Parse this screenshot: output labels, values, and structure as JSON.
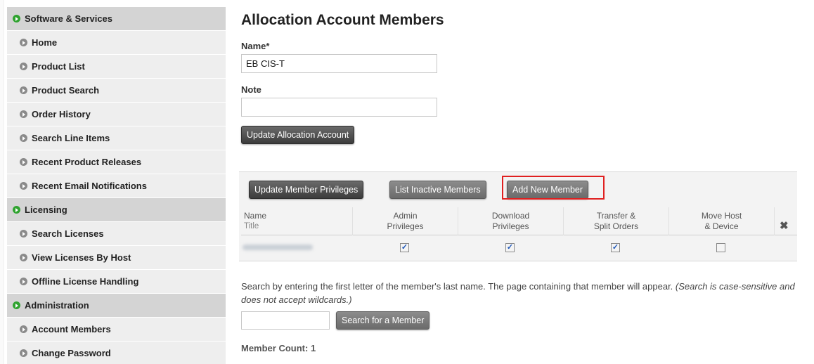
{
  "sidebar": {
    "items": [
      {
        "label": "Software & Services",
        "type": "section"
      },
      {
        "label": "Home",
        "type": "item"
      },
      {
        "label": "Product List",
        "type": "item"
      },
      {
        "label": "Product Search",
        "type": "item"
      },
      {
        "label": "Order History",
        "type": "item"
      },
      {
        "label": "Search Line Items",
        "type": "item"
      },
      {
        "label": "Recent Product Releases",
        "type": "item"
      },
      {
        "label": "Recent Email Notifications",
        "type": "item"
      },
      {
        "label": "Licensing",
        "type": "section"
      },
      {
        "label": "Search Licenses",
        "type": "item"
      },
      {
        "label": "View Licenses By Host",
        "type": "item"
      },
      {
        "label": "Offline License Handling",
        "type": "item"
      },
      {
        "label": "Administration",
        "type": "section"
      },
      {
        "label": "Account Members",
        "type": "item"
      },
      {
        "label": "Change Password",
        "type": "item"
      }
    ]
  },
  "page": {
    "title": "Allocation Account Members"
  },
  "form": {
    "name_label": "Name*",
    "name_value": "EB CIS-T",
    "note_label": "Note",
    "note_value": "",
    "update_button": "Update Allocation Account"
  },
  "members": {
    "update_privileges_button": "Update Member Privileges",
    "list_inactive_button": "List Inactive Members",
    "add_member_button": "Add New Member",
    "columns": {
      "name": "Name",
      "title": "Title",
      "admin": [
        "Admin",
        "Privileges"
      ],
      "download": [
        "Download",
        "Privileges"
      ],
      "transfer": [
        "Transfer &",
        "Split Orders"
      ],
      "move": [
        "Move Host",
        "& Device"
      ]
    },
    "rows": [
      {
        "admin": true,
        "download": true,
        "transfer": true,
        "move": false
      }
    ]
  },
  "search": {
    "help_text": "Search by entering the first letter of the member's last name. The page containing that member will appear. ",
    "help_note": "(Search is case-sensitive and does not accept wildcards.)",
    "input_value": "",
    "button": "Search for a Member"
  },
  "footer": {
    "member_count": "Member Count: 1"
  },
  "colors": {
    "section_bullet": "#2fa32f",
    "item_bullet": "#8a8a8a",
    "button_dark": "#3c3c3c",
    "highlight": "#e02020"
  }
}
